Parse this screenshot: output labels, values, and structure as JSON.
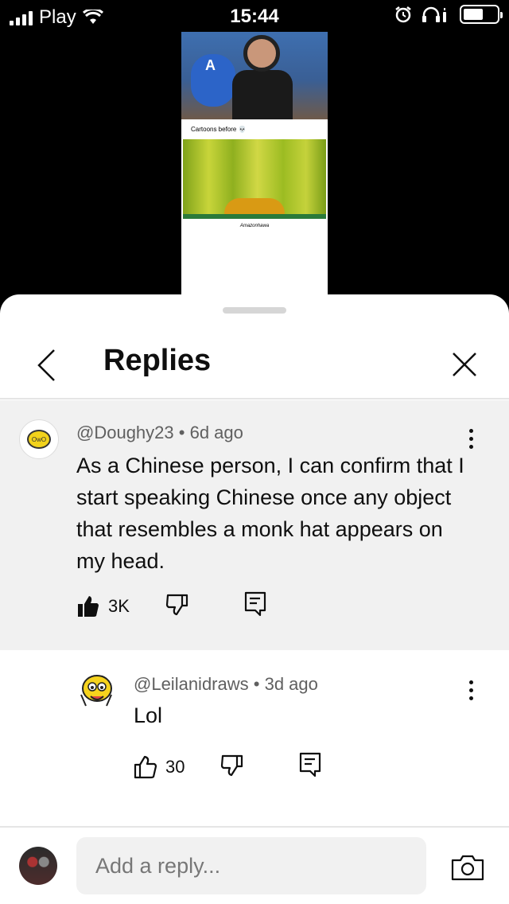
{
  "status_bar": {
    "carrier": "Play",
    "time": "15:44"
  },
  "video": {
    "caption": "Cartoons before 💀",
    "subtitle": "Amazonhawa"
  },
  "sheet": {
    "title": "Replies"
  },
  "parent_comment": {
    "author": "@Doughy23",
    "age": "6d ago",
    "separator": "•",
    "text": "As a Chinese person, I can confirm that I start speaking Chinese once any object that resembles a monk hat appears on my head.",
    "likes": "3K",
    "avatar_text": "OwO"
  },
  "reply": {
    "author": "@Leilanidraws",
    "age": "3d ago",
    "separator": "•",
    "text": "Lol",
    "likes": "30"
  },
  "composer": {
    "placeholder": "Add a reply..."
  },
  "icons": {
    "back": "chevron-left-icon",
    "close": "close-icon",
    "more": "more-vertical-icon",
    "like": "thumbs-up-icon",
    "dislike": "thumbs-down-icon",
    "reply": "comment-reply-icon",
    "camera": "camera-icon"
  },
  "colors": {
    "text_primary": "#0f0f0f",
    "text_secondary": "#606060",
    "highlight_bg": "#f1f1f1"
  }
}
